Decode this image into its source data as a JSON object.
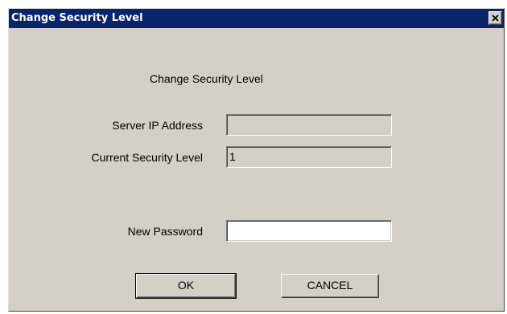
{
  "window": {
    "title": "Change Security Level",
    "titlebar_color": "#0a246a",
    "background_color": "#d4d0c8"
  },
  "dialog": {
    "heading": "Change Security Level",
    "server_ip": {
      "label": "Server IP Address",
      "value": ""
    },
    "security_level": {
      "label": "Current Security Level",
      "value": "1"
    },
    "new_password": {
      "label": "New Password",
      "value": ""
    }
  },
  "buttons": {
    "ok_label": "OK",
    "cancel_label": "CANCEL"
  },
  "icons": {
    "close": "close-icon"
  }
}
